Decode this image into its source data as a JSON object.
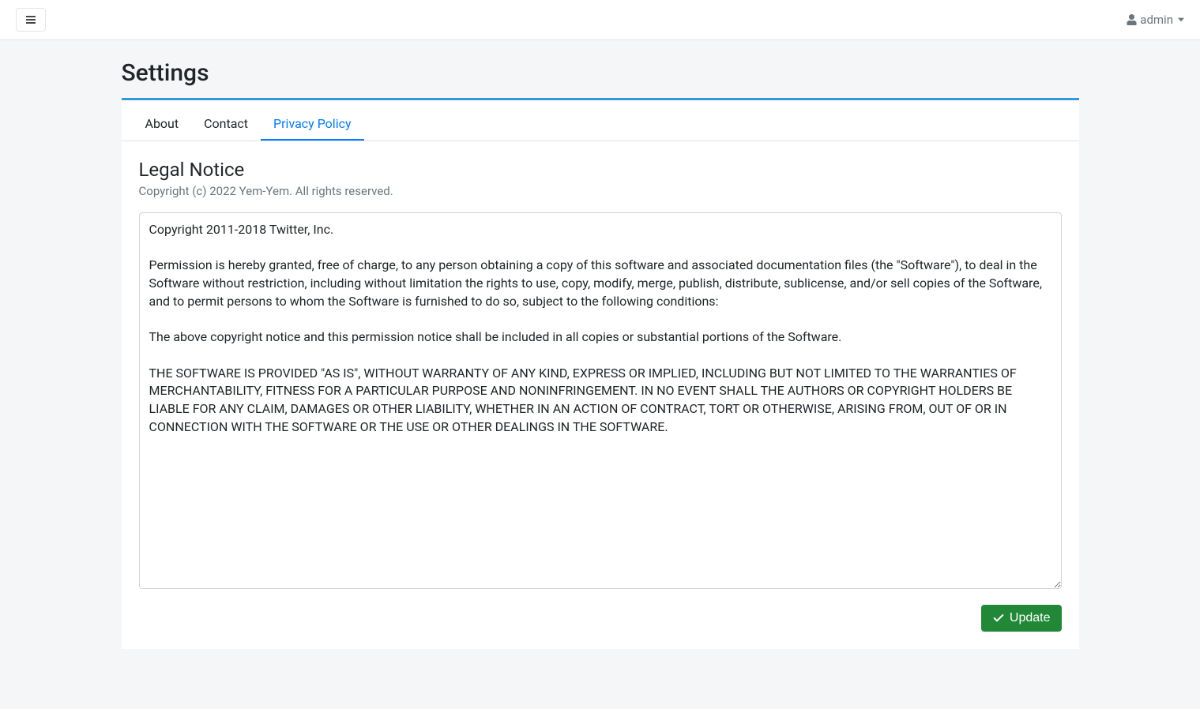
{
  "header": {
    "user_label": "admin"
  },
  "page": {
    "title": "Settings"
  },
  "tabs": [
    {
      "label": "About",
      "active": false
    },
    {
      "label": "Contact",
      "active": false
    },
    {
      "label": "Privacy Policy",
      "active": true
    }
  ],
  "section": {
    "title": "Legal Notice",
    "subtitle": "Copyright (c) 2022 Yem-Yem. All rights reserved.",
    "content": "Copyright 2011-2018 Twitter, Inc.\n\nPermission is hereby granted, free of charge, to any person obtaining a copy of this software and associated documentation files (the \"Software\"), to deal in the Software without restriction, including without limitation the rights to use, copy, modify, merge, publish, distribute, sublicense, and/or sell copies of the Software, and to permit persons to whom the Software is furnished to do so, subject to the following conditions:\n\nThe above copyright notice and this permission notice shall be included in all copies or substantial portions of the Software.\n\nTHE SOFTWARE IS PROVIDED \"AS IS\", WITHOUT WARRANTY OF ANY KIND, EXPRESS OR IMPLIED, INCLUDING BUT NOT LIMITED TO THE WARRANTIES OF MERCHANTABILITY, FITNESS FOR A PARTICULAR PURPOSE AND NONINFRINGEMENT. IN NO EVENT SHALL THE AUTHORS OR COPYRIGHT HOLDERS BE LIABLE FOR ANY CLAIM, DAMAGES OR OTHER LIABILITY, WHETHER IN AN ACTION OF CONTRACT, TORT OR OTHERWISE, ARISING FROM, OUT OF OR IN CONNECTION WITH THE SOFTWARE OR THE USE OR OTHER DEALINGS IN THE SOFTWARE."
  },
  "actions": {
    "update_label": "Update"
  }
}
